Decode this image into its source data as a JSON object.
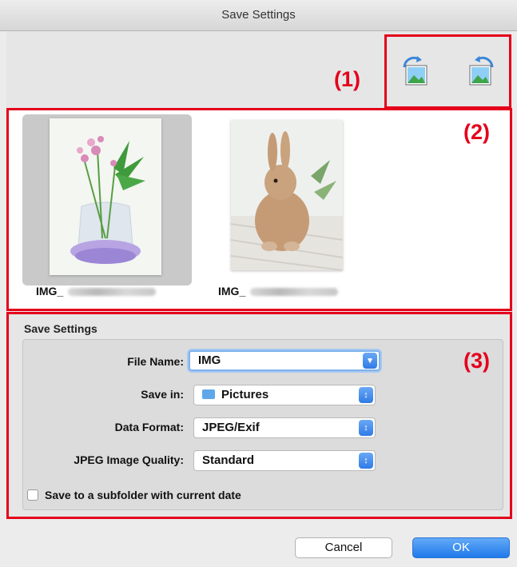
{
  "window": {
    "title": "Save Settings"
  },
  "callouts": {
    "c1": "(1)",
    "c2": "(2)",
    "c3": "(3)"
  },
  "toolbar": {
    "buttons": [
      "rotate-left-icon",
      "rotate-right-icon"
    ]
  },
  "thumbnails": [
    {
      "label": "IMG_",
      "subject": "flowers in glass vase",
      "selected": true
    },
    {
      "label": "IMG_",
      "subject": "rabbit"
    }
  ],
  "settings": {
    "section_title": "Save Settings",
    "file_name_label": "File Name:",
    "file_name_value": "IMG",
    "save_in_label": "Save in:",
    "save_in_value": "Pictures",
    "data_format_label": "Data Format:",
    "data_format_value": "JPEG/Exif",
    "jpeg_quality_label": "JPEG Image Quality:",
    "jpeg_quality_value": "Standard",
    "subfolder_label": "Save to a subfolder with current date",
    "subfolder_checked": false
  },
  "buttons": {
    "cancel": "Cancel",
    "ok": "OK"
  },
  "colors": {
    "callout_red": "#e4001b",
    "accent_blue": "#2f7be6"
  }
}
